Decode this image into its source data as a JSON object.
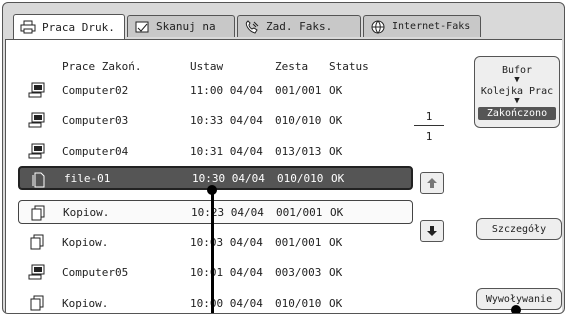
{
  "tabs": [
    {
      "label": "Praca Druk.",
      "icon": "printer-icon"
    },
    {
      "label": "Skanuj na",
      "icon": "scan-document-icon"
    },
    {
      "label": "Zad. Faks.",
      "icon": "fax-phone-icon"
    },
    {
      "label": "Internet-Faks",
      "icon": "internet-fax-icon"
    }
  ],
  "columns": {
    "name": "Prace Zakoń.",
    "time": "Ustaw",
    "sets": "Zesta",
    "status": "Status"
  },
  "rows": [
    {
      "icon": "computer-icon",
      "name": "Computer02",
      "time": "11:00 04/04",
      "sets": "001/001",
      "status": "OK"
    },
    {
      "icon": "computer-icon",
      "name": "Computer03",
      "time": "10:33 04/04",
      "sets": "010/010",
      "status": "OK"
    },
    {
      "icon": "computer-icon",
      "name": "Computer04",
      "time": "10:31 04/04",
      "sets": "013/013",
      "status": "OK"
    },
    {
      "icon": "file-icon",
      "name": "file-01",
      "time": "10:30 04/04",
      "sets": "010/010",
      "status": "OK"
    },
    {
      "icon": "copy-icon",
      "name": "Kopiow.",
      "time": "10:23 04/04",
      "sets": "001/001",
      "status": "OK"
    },
    {
      "icon": "copy-icon",
      "name": "Kopiow.",
      "time": "10:03 04/04",
      "sets": "001/001",
      "status": "OK"
    },
    {
      "icon": "computer-icon",
      "name": "Computer05",
      "time": "10:01 04/04",
      "sets": "003/003",
      "status": "OK"
    },
    {
      "icon": "copy-icon",
      "name": "Kopiow.",
      "time": "10:00 04/04",
      "sets": "010/010",
      "status": "OK"
    }
  ],
  "pager": {
    "current": "1",
    "total": "1"
  },
  "job_queue": {
    "option1": "Bufor",
    "option2": "Kolejka Prac",
    "option3": "Zakończono"
  },
  "buttons": {
    "details": "Szczegóły",
    "recall": "Wywoływanie"
  }
}
